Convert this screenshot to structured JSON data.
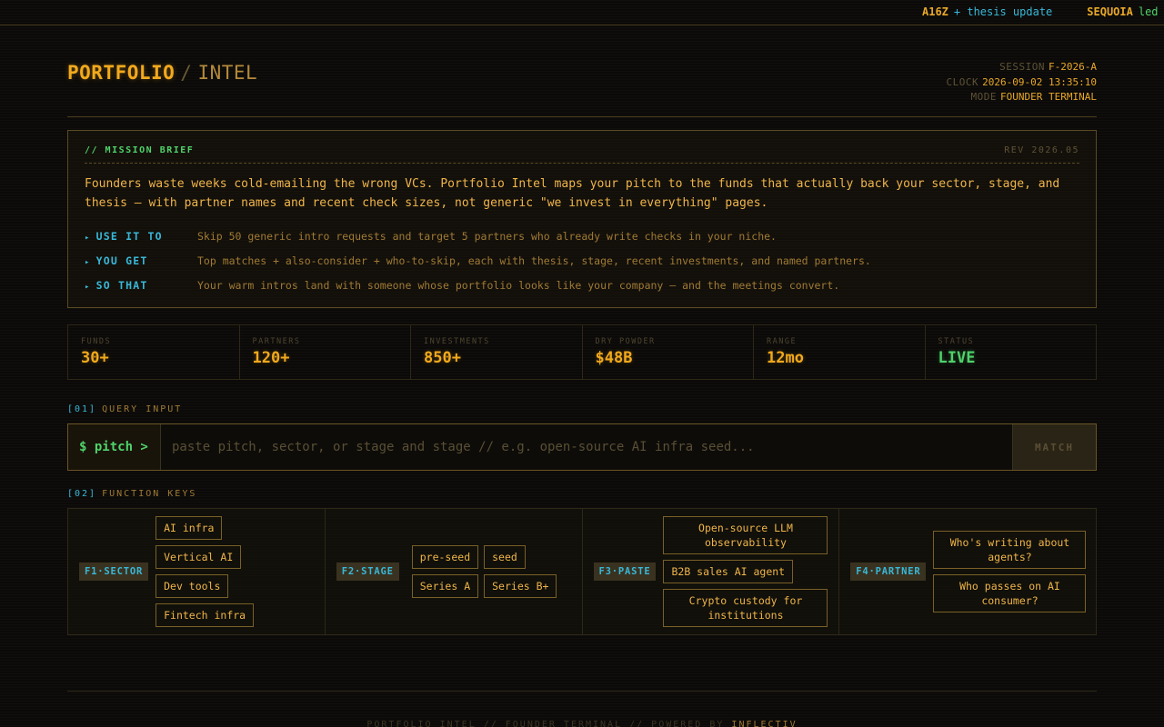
{
  "ticker": [
    {
      "fund": "A16Z",
      "text": "+ thesis update",
      "color": "#38b8d8"
    },
    {
      "fund": "SEQUOIA",
      "text": "led",
      "color": "#4fd26a"
    }
  ],
  "header": {
    "brand_main": "PORTFOLIO",
    "brand_sep": "/",
    "brand_sub": "INTEL",
    "meta": [
      {
        "label": "SESSION",
        "value": "F-2026-A"
      },
      {
        "label": "CLOCK",
        "value": "2026-09-02 13:35:10"
      },
      {
        "label": "MODE",
        "value": "FOUNDER TERMINAL"
      }
    ]
  },
  "brief": {
    "title": "// MISSION BRIEF",
    "rev": "REV 2026.05",
    "body": "Founders waste weeks cold-emailing the wrong VCs. Portfolio Intel maps your pitch to the funds that actually back your sector, stage, and thesis — with partner names and recent check sizes, not generic \"we invest in everything\" pages.",
    "rows": [
      {
        "key": "USE IT TO",
        "value": "Skip 50 generic intro requests and target 5 partners who already write checks in your niche."
      },
      {
        "key": "YOU GET",
        "value": "Top matches + also-consider + who-to-skip, each with thesis, stage, recent investments, and named partners."
      },
      {
        "key": "SO THAT",
        "value": "Your warm intros land with someone whose portfolio looks like your company — and the meetings convert."
      }
    ]
  },
  "stats": [
    {
      "label": "FUNDS",
      "value": "30+"
    },
    {
      "label": "PARTNERS",
      "value": "120+"
    },
    {
      "label": "INVESTMENTS",
      "value": "850+"
    },
    {
      "label": "DRY POWDER",
      "value": "$48B"
    },
    {
      "label": "RANGE",
      "value": "12mo"
    },
    {
      "label": "STATUS",
      "value": "LIVE"
    }
  ],
  "query": {
    "section_num": "[01]",
    "section_label": "QUERY INPUT",
    "prompt": "$ pitch >",
    "placeholder": "paste pitch, sector, or stage and stage // e.g. open-source AI infra seed...",
    "value": "",
    "button": "MATCH"
  },
  "fkeys": {
    "section_num": "[02]",
    "section_label": "FUNCTION KEYS",
    "groups": [
      {
        "tag": "F1·SECTOR",
        "chips": [
          "AI infra",
          "Vertical AI",
          "Dev tools",
          "Fintech infra"
        ]
      },
      {
        "tag": "F2·STAGE",
        "chips": [
          "pre-seed",
          "seed",
          "Series A",
          "Series B+"
        ]
      },
      {
        "tag": "F3·PASTE",
        "chips": [
          "Open-source LLM observability",
          "B2B sales AI agent",
          "Crypto custody for institutions"
        ]
      },
      {
        "tag": "F4·PARTNER",
        "chips": [
          "Who's writing about agents?",
          "Who passes on AI consumer?"
        ]
      }
    ]
  },
  "footer": {
    "text": "PORTFOLIO INTEL // FOUNDER TERMINAL // POWERED BY",
    "brand": "INFLECTIV"
  }
}
